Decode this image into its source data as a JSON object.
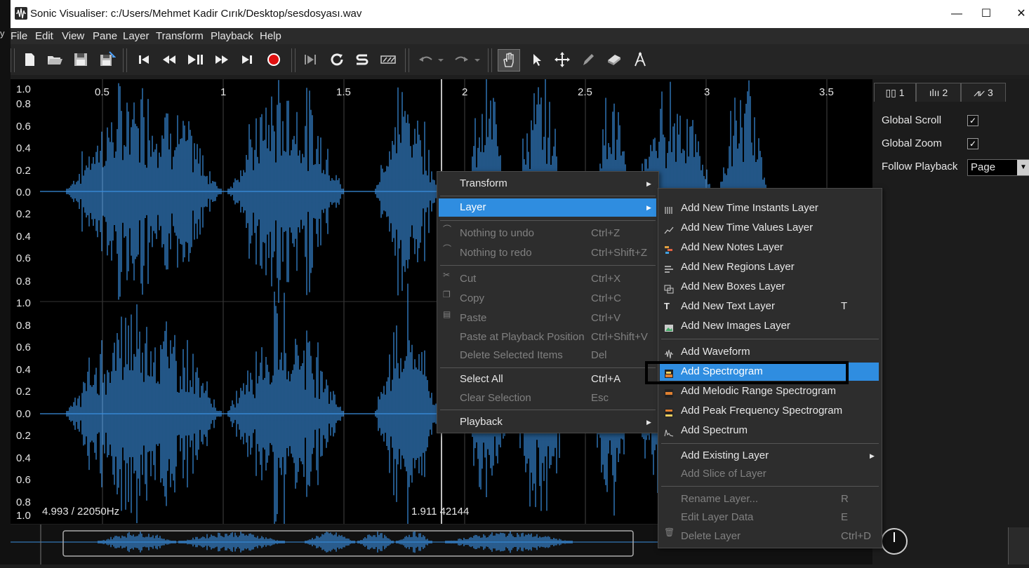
{
  "window": {
    "title": "Sonic Visualiser: c:/Users/Mehmet Kadir Cırık/Desktop/sesdosyası.wav",
    "minimize": "—",
    "maximize": "☐",
    "close": "✕",
    "edge_char": "y"
  },
  "menubar": [
    "File",
    "Edit",
    "View",
    "Pane",
    "Layer",
    "Transform",
    "Playback",
    "Help"
  ],
  "waveform": {
    "y_labels_top": [
      "1.0",
      "0.8",
      "0.6",
      "0.4",
      "0.2",
      "0.0",
      "0.2",
      "0.4",
      "0.6",
      "0.8"
    ],
    "y_labels_bottom": [
      "1.0",
      "0.8",
      "0.6",
      "0.4",
      "0.2",
      "0.0",
      "0.2",
      "0.4",
      "0.6",
      "0.8",
      "1.0"
    ],
    "x_labels": [
      "0.5",
      "1",
      "1.5",
      "2",
      "2.5",
      "3",
      "3.5"
    ],
    "info_left": "4.993 / 22050Hz",
    "info_center": "1.911 42144",
    "color": "#3a8fe0"
  },
  "right_panel": {
    "tabs": [
      "1",
      "2",
      "3"
    ],
    "global_scroll_label": "Global Scroll",
    "global_scroll_checked": "✓",
    "global_zoom_label": "Global Zoom",
    "global_zoom_checked": "✓",
    "follow_playback_label": "Follow Playback",
    "follow_playback_value": "Page"
  },
  "context_menu": {
    "transform": "Transform",
    "layer": "Layer",
    "undo": {
      "label": "Nothing to undo",
      "shortcut": "Ctrl+Z"
    },
    "redo": {
      "label": "Nothing to redo",
      "shortcut": "Ctrl+Shift+Z"
    },
    "cut": {
      "label": "Cut",
      "shortcut": "Ctrl+X"
    },
    "copy": {
      "label": "Copy",
      "shortcut": "Ctrl+C"
    },
    "paste": {
      "label": "Paste",
      "shortcut": "Ctrl+V"
    },
    "paste_at_playback": {
      "label": "Paste at Playback Position",
      "shortcut": "Ctrl+Shift+V"
    },
    "delete_selected": {
      "label": "Delete Selected Items",
      "shortcut": "Del"
    },
    "select_all": {
      "label": "Select All",
      "shortcut": "Ctrl+A"
    },
    "clear_selection": {
      "label": "Clear Selection",
      "shortcut": "Esc"
    },
    "playback": "Playback"
  },
  "layer_submenu": {
    "time_instants": "Add New Time Instants Layer",
    "time_values": "Add New Time Values Layer",
    "notes": "Add New Notes Layer",
    "regions": "Add New Regions Layer",
    "boxes": "Add New Boxes Layer",
    "text": {
      "label": "Add New Text Layer",
      "shortcut": "T"
    },
    "images": "Add New Images Layer",
    "waveform": "Add Waveform",
    "spectrogram": "Add Spectrogram",
    "melodic": "Add Melodic Range Spectrogram",
    "peak_freq": "Add Peak Frequency Spectrogram",
    "spectrum": "Add Spectrum",
    "existing": "Add Existing Layer",
    "slice": "Add Slice of Layer",
    "rename": {
      "label": "Rename Layer...",
      "shortcut": "R"
    },
    "edit_data": {
      "label": "Edit Layer Data",
      "shortcut": "E"
    },
    "delete": {
      "label": "Delete Layer",
      "shortcut": "Ctrl+D"
    }
  }
}
